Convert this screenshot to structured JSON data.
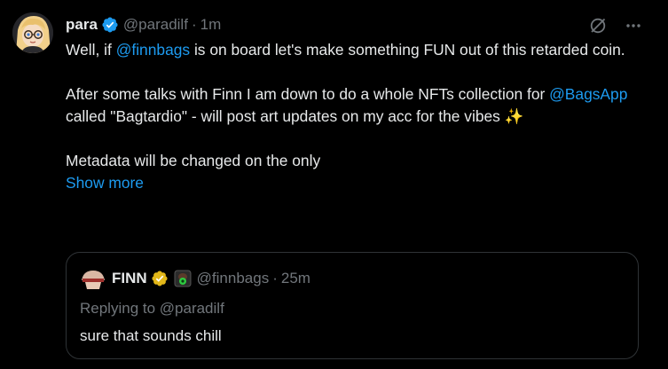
{
  "tweet": {
    "name": "para",
    "handle": "@paradilf",
    "dot": "·",
    "time": "1m",
    "lines": {
      "l1_pre": "Well, if ",
      "l1_mention": "@finnbags",
      "l1_post": " is on board let's make something FUN out of this retarded coin.",
      "l2_pre": "After some talks with Finn I am down to do a whole NFTs collection for ",
      "l2_mention": "@BagsApp",
      "l2_post": " called \"Bagtardio\" - will post art updates on my acc for the vibes ",
      "l2_emoji": "✨",
      "l3": "Metadata will be changed on the only"
    },
    "show_more": "Show more",
    "icons": [
      "grok-slash-icon",
      "more-icon"
    ]
  },
  "quote": {
    "name": "FINN",
    "handle": "@finnbags",
    "dot": "·",
    "time": "25m",
    "replying_to": "Replying to @paradilf",
    "text": "sure that sounds chill",
    "icons": [
      "gold-verified-badge-icon",
      "affiliate-badge-icon"
    ]
  },
  "colors": {
    "background": "#000000",
    "text": "#e7e9ea",
    "muted": "#71767b",
    "link": "#1d9bf0",
    "border": "#2f3336",
    "verified_blue": "#1d9bf0",
    "verified_gold": "#e2b719"
  }
}
